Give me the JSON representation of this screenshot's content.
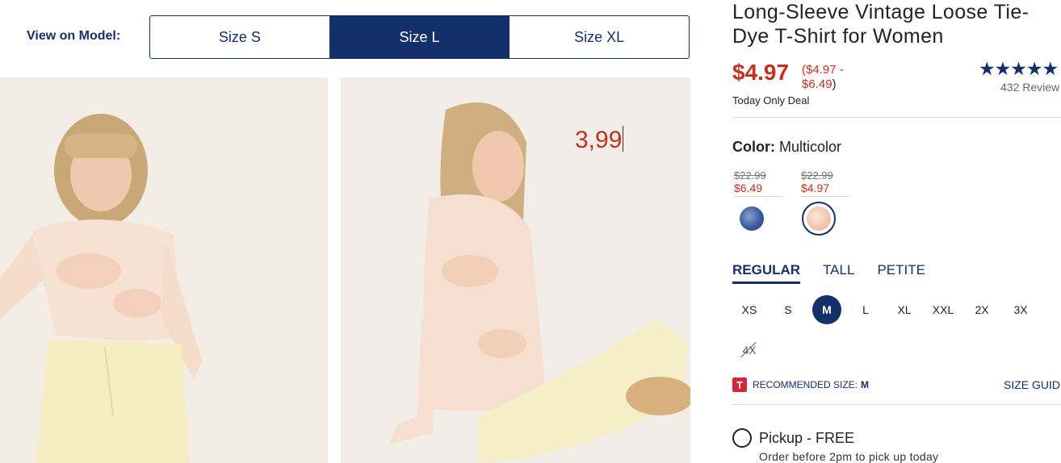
{
  "view_on_model": {
    "label": "View on Model:",
    "options": [
      "Size S",
      "Size L",
      "Size XL"
    ],
    "selected": "Size L"
  },
  "photo_overlay": {
    "typed_price": "3,99"
  },
  "product": {
    "title_line1": "Long-Sleeve Vintage Loose Tie-",
    "title_line2": "Dye T-Shirt for Women",
    "price": "$4.97",
    "price_range_line1": "($4.97 -",
    "price_range_line2": "$6.49",
    "price_range_close": ")",
    "deal": "Today Only Deal",
    "rating_stars": "★★★★★",
    "reviews": "432 Review"
  },
  "color": {
    "label": "Color:",
    "value": "Multicolor",
    "swatches": [
      {
        "old_price": "$22.99",
        "new_price": "$6.49",
        "name": "blue-tie-dye",
        "color": "#3b5a9c"
      },
      {
        "old_price": "$22.99",
        "new_price": "$4.97",
        "name": "peach-tie-dye",
        "color": "#f2c3ad"
      }
    ]
  },
  "fit_tabs": [
    "REGULAR",
    "TALL",
    "PETITE"
  ],
  "sizes": [
    "XS",
    "S",
    "M",
    "L",
    "XL",
    "XXL",
    "2X",
    "3X"
  ],
  "selected_size": "M",
  "unavailable_size": "4X",
  "recommended": {
    "icon": "T",
    "label": "RECOMMENDED SIZE:",
    "value": "M"
  },
  "size_guide": "SIZE GUID",
  "pickup": {
    "label": "Pickup - FREE",
    "sub": "Order before 2pm to pick up today"
  },
  "colors": {
    "navy": "#13306a",
    "sale_red": "#c2331e",
    "badge_red": "#d6263a"
  }
}
